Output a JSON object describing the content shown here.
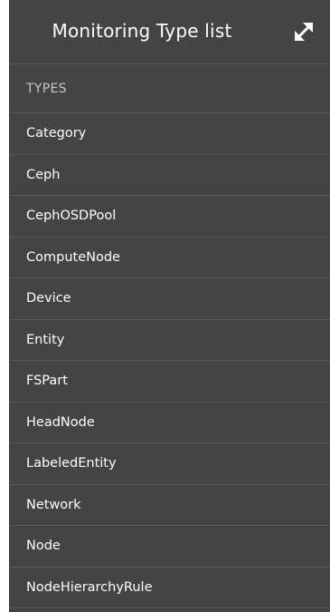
{
  "panel": {
    "title": "Monitoring Type list",
    "expand_icon": "expand-arrows-icon"
  },
  "section": {
    "label": "TYPES"
  },
  "types": [
    {
      "label": "Category"
    },
    {
      "label": "Ceph"
    },
    {
      "label": "CephOSDPool"
    },
    {
      "label": "ComputeNode"
    },
    {
      "label": "Device"
    },
    {
      "label": "Entity"
    },
    {
      "label": "FSPart"
    },
    {
      "label": "HeadNode"
    },
    {
      "label": "LabeledEntity"
    },
    {
      "label": "Network"
    },
    {
      "label": "Node"
    },
    {
      "label": "NodeHierarchyRule"
    }
  ],
  "colors": {
    "panel_bg": "#444444",
    "divider": "#5a5a5a",
    "text": "#ffffff",
    "muted_text": "#c8c8c8"
  }
}
